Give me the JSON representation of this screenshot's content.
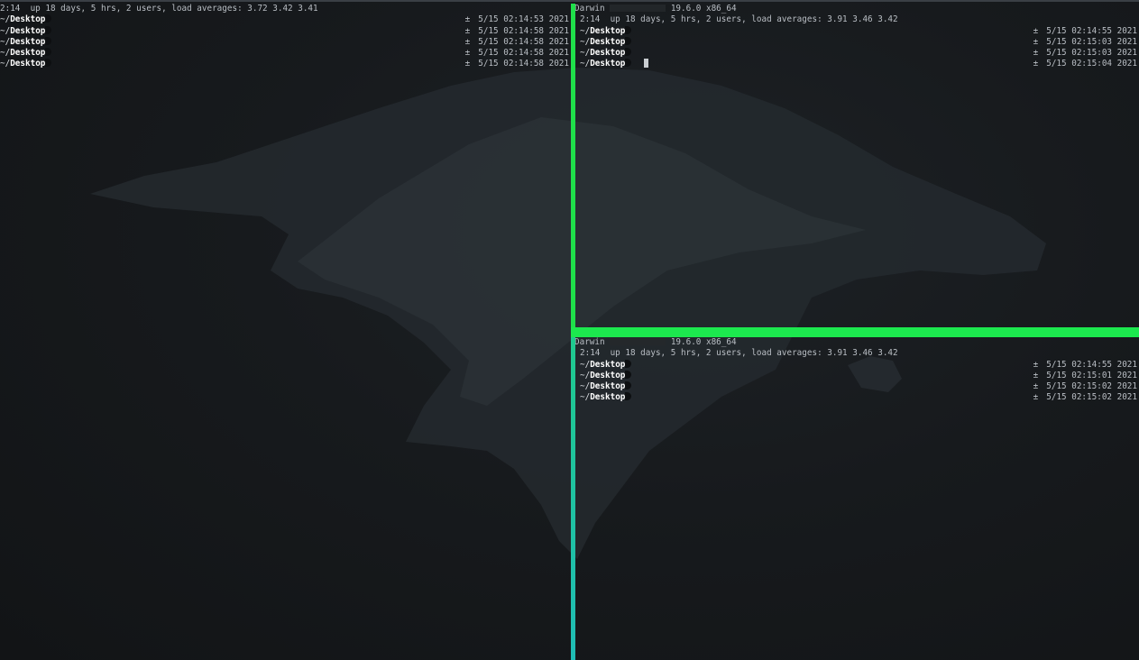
{
  "colors": {
    "active_divider": "#1fe04a",
    "inactive_divider": "#1fbdb5",
    "background": "#14171a",
    "text": "#b9bec4"
  },
  "panes": {
    "left": {
      "lines": [
        {
          "text": "2:14  up 18 days, 5 hrs, 2 users, load averages: 3.72 3.42 3.41"
        }
      ],
      "prompts": [
        {
          "path": "~/",
          "dir": "Desktop",
          "git": "±",
          "time": "5/15 02:14:53 2021"
        },
        {
          "path": "~/",
          "dir": "Desktop",
          "git": "±",
          "time": "5/15 02:14:58 2021"
        },
        {
          "path": "~/",
          "dir": "Desktop",
          "git": "±",
          "time": "5/15 02:14:58 2021"
        },
        {
          "path": "~/",
          "dir": "Desktop",
          "git": "±",
          "time": "5/15 02:14:58 2021"
        },
        {
          "path": "~/",
          "dir": "Desktop",
          "git": "±",
          "time": "5/15 02:14:58 2021"
        }
      ]
    },
    "top_right": {
      "system_prefix": "Darwin",
      "system_suffix": "19.6.0 x86_64",
      "uptime": "2:14  up 18 days, 5 hrs, 2 users, load averages: 3.91 3.46 3.42",
      "prompts": [
        {
          "path": "~/",
          "dir": "Desktop",
          "git": "±",
          "time": "5/15 02:14:55 2021"
        },
        {
          "path": "~/",
          "dir": "Desktop",
          "git": "±",
          "time": "5/15 02:15:03 2021"
        },
        {
          "path": "~/",
          "dir": "Desktop",
          "git": "±",
          "time": "5/15 02:15:03 2021"
        },
        {
          "path": "~/",
          "dir": "Desktop",
          "git": "±",
          "time": "5/15 02:15:04 2021"
        }
      ]
    },
    "bottom_right": {
      "system_prefix": "Darwin",
      "system_suffix": "19.6.0 x86_64",
      "uptime": "2:14  up 18 days, 5 hrs, 2 users, load averages: 3.91 3.46 3.42",
      "prompts": [
        {
          "path": "~/",
          "dir": "Desktop",
          "git": "±",
          "time": "5/15 02:14:55 2021"
        },
        {
          "path": "~/",
          "dir": "Desktop",
          "git": "±",
          "time": "5/15 02:15:01 2021"
        },
        {
          "path": "~/",
          "dir": "Desktop",
          "git": "±",
          "time": "5/15 02:15:02 2021"
        },
        {
          "path": "~/",
          "dir": "Desktop",
          "git": "±",
          "time": "5/15 02:15:02 2021"
        }
      ]
    }
  }
}
